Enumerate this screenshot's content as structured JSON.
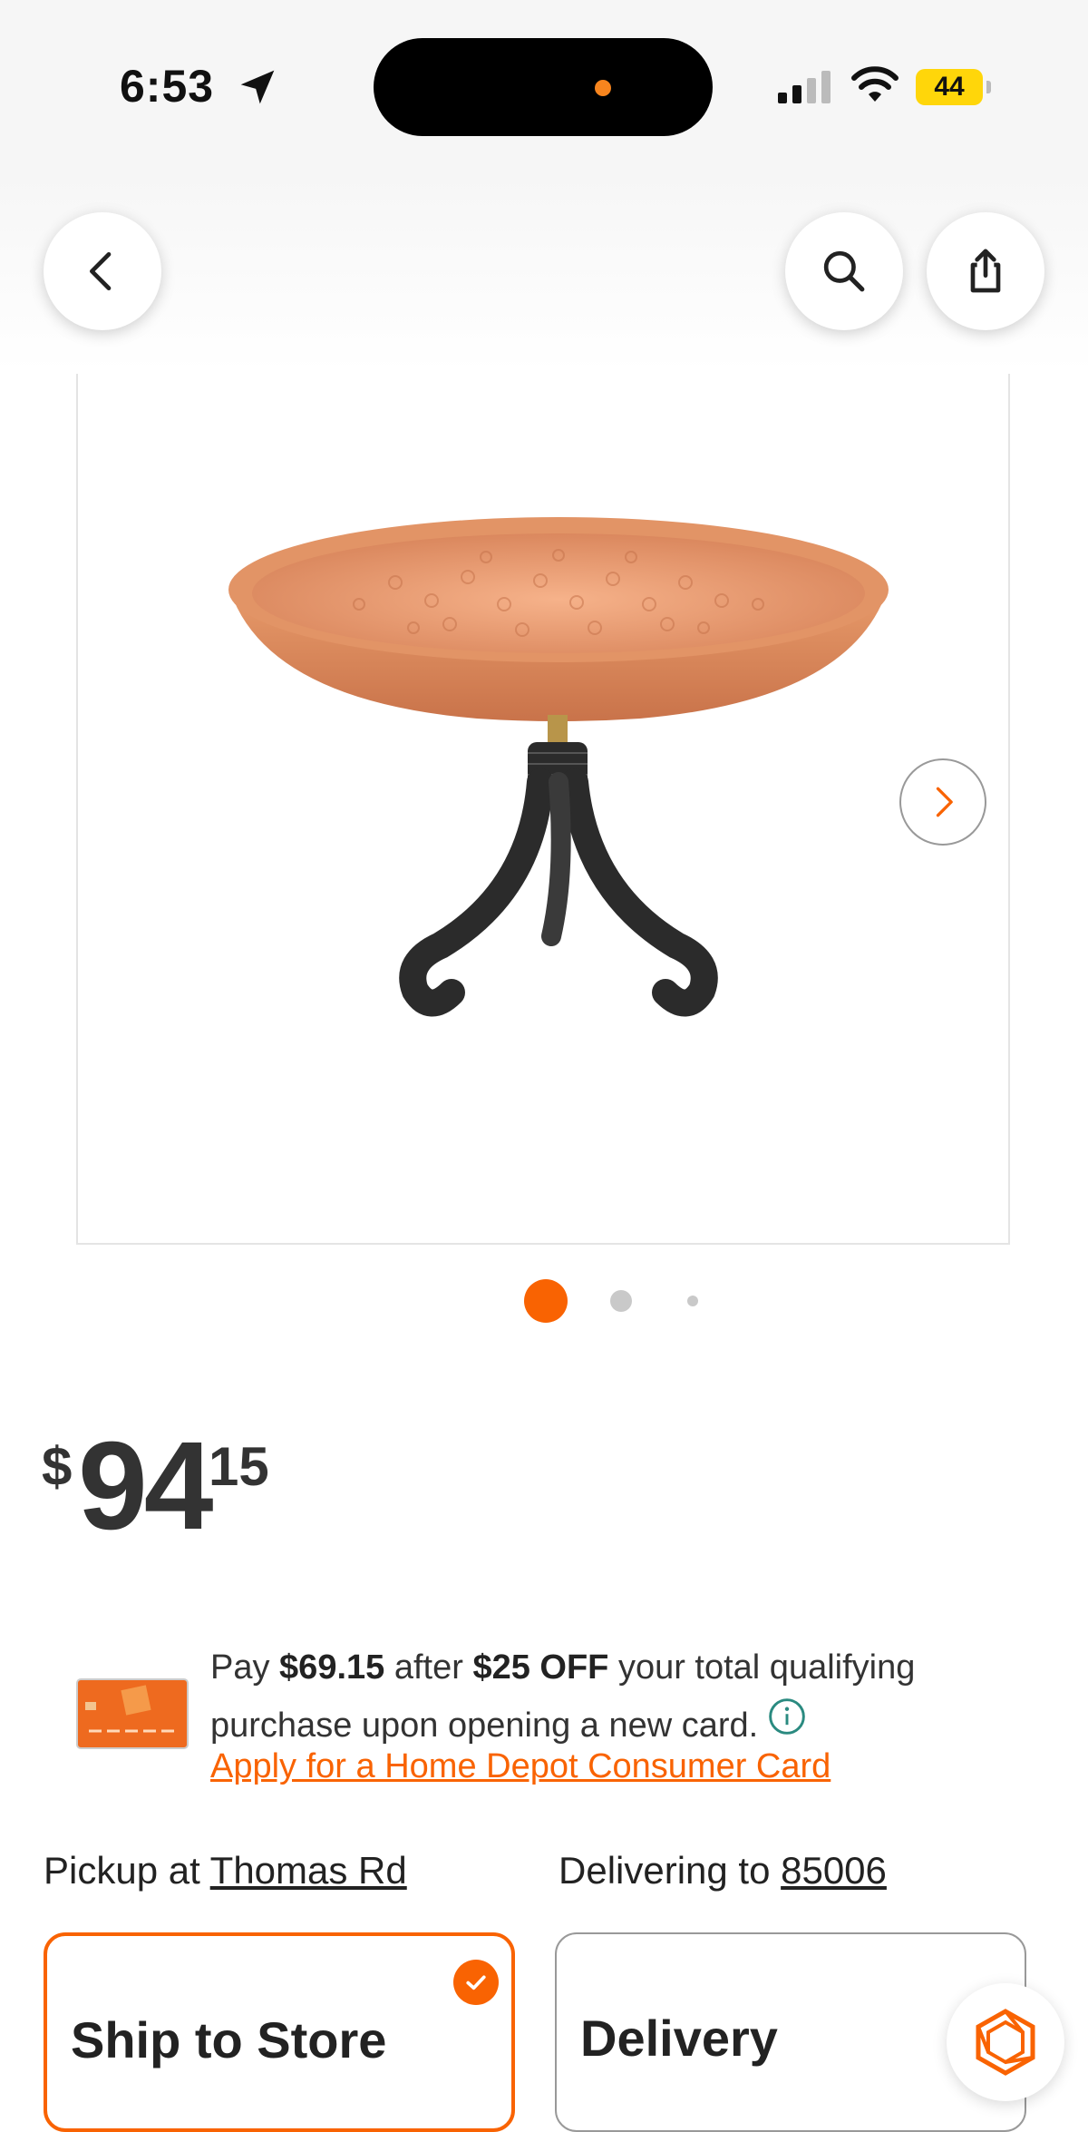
{
  "status_bar": {
    "time": "6:53",
    "battery": "44"
  },
  "header": {
    "back_icon": "chevron-left-icon",
    "search_icon": "search-icon",
    "share_icon": "share-icon"
  },
  "gallery": {
    "image_alt": "copper bird bath bowl on black tripod stand",
    "next_icon": "chevron-right-icon",
    "image_count": 3,
    "active_index": 0
  },
  "price": {
    "currency": "$",
    "dollars": "94",
    "cents": "15"
  },
  "promo": {
    "text_pay": "Pay ",
    "amount": "$69.15",
    "text_after": " after ",
    "off": "$25 OFF",
    "text_rest": " your total qualifying purchase upon opening a new card.",
    "link": "Apply for a Home Depot Consumer Card"
  },
  "fulfillment": {
    "pickup_prefix": "Pickup at ",
    "pickup_store": "Thomas Rd",
    "delivery_prefix": "Delivering to ",
    "delivery_zip": "85006",
    "options": [
      {
        "label": "Ship to Store",
        "selected": true
      },
      {
        "label": "Delivery",
        "selected": false
      }
    ]
  },
  "colors": {
    "accent": "#f96302",
    "text": "#222222",
    "border": "#999999"
  }
}
